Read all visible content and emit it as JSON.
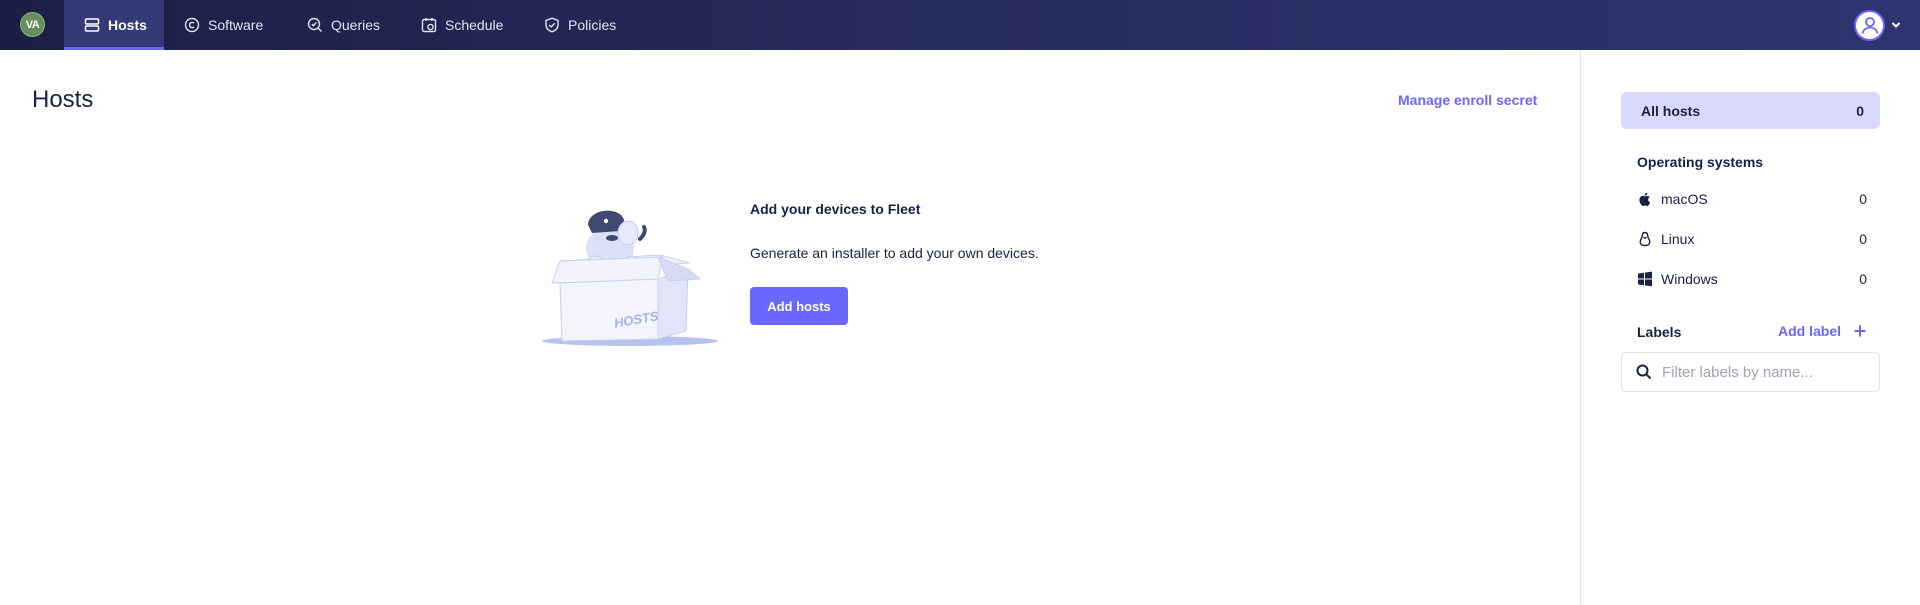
{
  "nav": {
    "org_initials": "VA",
    "items": [
      {
        "label": "Hosts",
        "icon": "hosts-icon",
        "active": true
      },
      {
        "label": "Software",
        "icon": "software-icon",
        "active": false
      },
      {
        "label": "Queries",
        "icon": "queries-icon",
        "active": false
      },
      {
        "label": "Schedule",
        "icon": "schedule-icon",
        "active": false
      },
      {
        "label": "Policies",
        "icon": "policies-icon",
        "active": false
      }
    ],
    "user_icon": "user-avatar-icon"
  },
  "main": {
    "title": "Hosts",
    "manage_enroll_secret": "Manage enroll secret",
    "empty_state": {
      "heading": "Add your devices to Fleet",
      "text": "Generate an installer to add your own devices.",
      "button_label": "Add hosts",
      "illustration_text": "HOSTS"
    }
  },
  "side_panel": {
    "all_hosts": {
      "label": "All hosts",
      "count": "0"
    },
    "os_heading": "Operating systems",
    "platforms": [
      {
        "label": "macOS",
        "count": "0",
        "icon": "apple-icon"
      },
      {
        "label": "Linux",
        "count": "0",
        "icon": "linux-icon"
      },
      {
        "label": "Windows",
        "count": "0",
        "icon": "windows-icon"
      }
    ],
    "labels_heading": "Labels",
    "add_label": "Add label",
    "search_placeholder": "Filter labels by name..."
  },
  "colors": {
    "nav_bg": "#1b1f45",
    "accent": "#6a67fe",
    "text": "#192147",
    "all_hosts_bg": "#d9d9fe"
  }
}
